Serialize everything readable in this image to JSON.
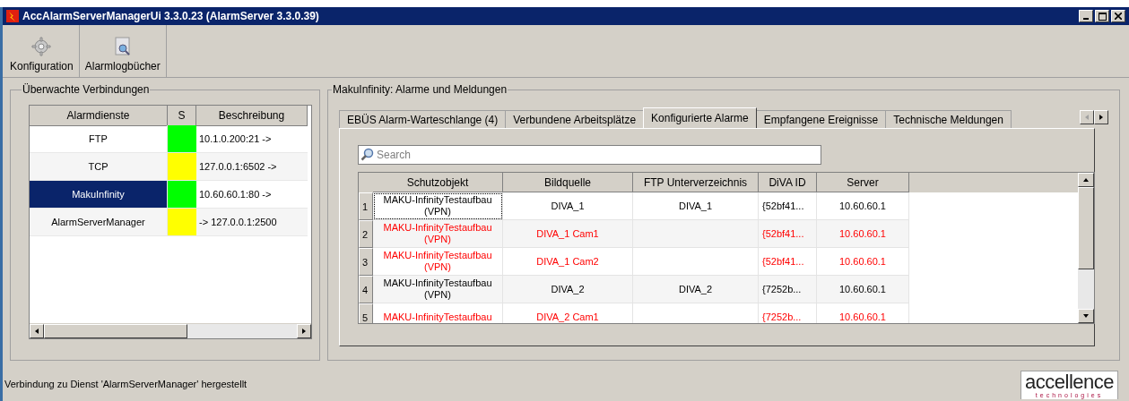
{
  "window": {
    "title": "AccAlarmServerManagerUi 3.3.0.23 (AlarmServer 3.3.0.39)"
  },
  "toolbar": [
    {
      "label": "Konfiguration"
    },
    {
      "label": "Alarmlogbücher"
    }
  ],
  "connections": {
    "title": "Überwachte Verbindungen",
    "columns": [
      "Alarmdienste",
      "S",
      "Beschreibung"
    ],
    "rows": [
      {
        "name": "FTP",
        "color": "#00ff00",
        "description": "10.1.0.200:21 ->",
        "selected": false
      },
      {
        "name": "TCP",
        "color": "#ffff00",
        "description": "127.0.0.1:6502 ->",
        "selected": false
      },
      {
        "name": "MakuInfinity",
        "color": "#00ff00",
        "description": "10.60.60.1:80 ->",
        "selected": true
      },
      {
        "name": "AlarmServerManager",
        "color": "#ffff00",
        "description": "-> 127.0.0.1:2500",
        "selected": false
      }
    ]
  },
  "alarms": {
    "title": "MakuInfinity: Alarme und Meldungen",
    "tabs": [
      {
        "label": "EBÜS Alarm-Warteschlange (4)",
        "selected": false
      },
      {
        "label": "Verbundene Arbeitsplätze",
        "selected": false
      },
      {
        "label": "Konfigurierte Alarme",
        "selected": true
      },
      {
        "label": "Empfangene Ereignisse",
        "selected": false
      },
      {
        "label": "Technische Meldungen",
        "selected": false
      }
    ],
    "search": {
      "placeholder": "Search"
    },
    "columns": [
      "Schutzobjekt",
      "Bildquelle",
      "FTP Unterverzeichnis",
      "DiVA ID",
      "Server"
    ],
    "rows": [
      {
        "number": "1",
        "cells": [
          "MAKU-InfinityTestaufbau (VPN)",
          "DIVA_1",
          "DIVA_1",
          "{52bf41...",
          "10.60.60.1"
        ],
        "warning": false,
        "selected": true
      },
      {
        "number": "2",
        "cells": [
          "MAKU-InfinityTestaufbau (VPN)",
          "DIVA_1 Cam1",
          "",
          "{52bf41...",
          "10.60.60.1"
        ],
        "warning": true,
        "selected": false
      },
      {
        "number": "3",
        "cells": [
          "MAKU-InfinityTestaufbau (VPN)",
          "DIVA_1 Cam2",
          "",
          "{52bf41...",
          "10.60.60.1"
        ],
        "warning": true,
        "selected": false
      },
      {
        "number": "4",
        "cells": [
          "MAKU-InfinityTestaufbau (VPN)",
          "DIVA_2",
          "DIVA_2",
          "{7252b...",
          "10.60.60.1"
        ],
        "warning": false,
        "selected": false
      },
      {
        "number": "5",
        "cells": [
          "MAKU-InfinityTestaufbau",
          "DIVA_2 Cam1",
          "",
          "{7252b...",
          "10.60.60.1"
        ],
        "warning": true,
        "selected": false
      }
    ]
  },
  "status_bar": {
    "text": "Verbindung zu Dienst 'AlarmServerManager' hergestellt"
  },
  "logo": {
    "name": "accellence",
    "tagline": "technologies"
  }
}
